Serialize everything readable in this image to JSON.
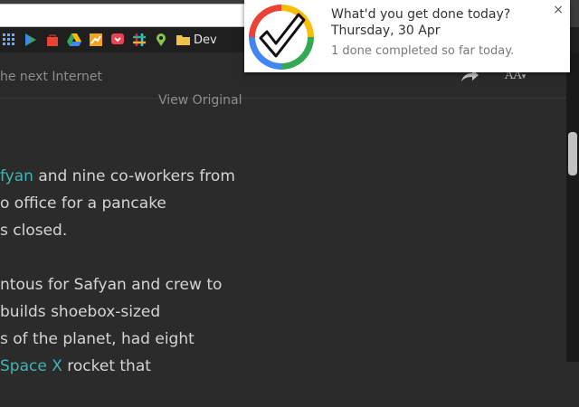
{
  "reader": {
    "title": "he next Internet",
    "view_original": "View Original",
    "font_size_label": "AA",
    "font_size_caret": "▾"
  },
  "bookmarks": {
    "dev_label": "Dev"
  },
  "article": {
    "p1_link": "fyan",
    "p1_line1_rest": " and nine co-workers from",
    "p1_line2": "o office for a pancake",
    "p1_line3": "s closed.",
    "p2_line1": "ntous for Safyan and crew to",
    "p2_line2": "builds shoebox-sized",
    "p2_line3": "s of the planet, had eight",
    "p2_line4_pre": "",
    "p2_line4_link": "Space X",
    "p2_line4_post": "rocket that"
  },
  "notification": {
    "title": "What'd you get done today?",
    "date": "Thursday, 30 Apr",
    "message": "1 done completed so far today.",
    "close": "×"
  },
  "colors": {
    "link": "#3fb5b5",
    "background": "#2b2b2b"
  }
}
